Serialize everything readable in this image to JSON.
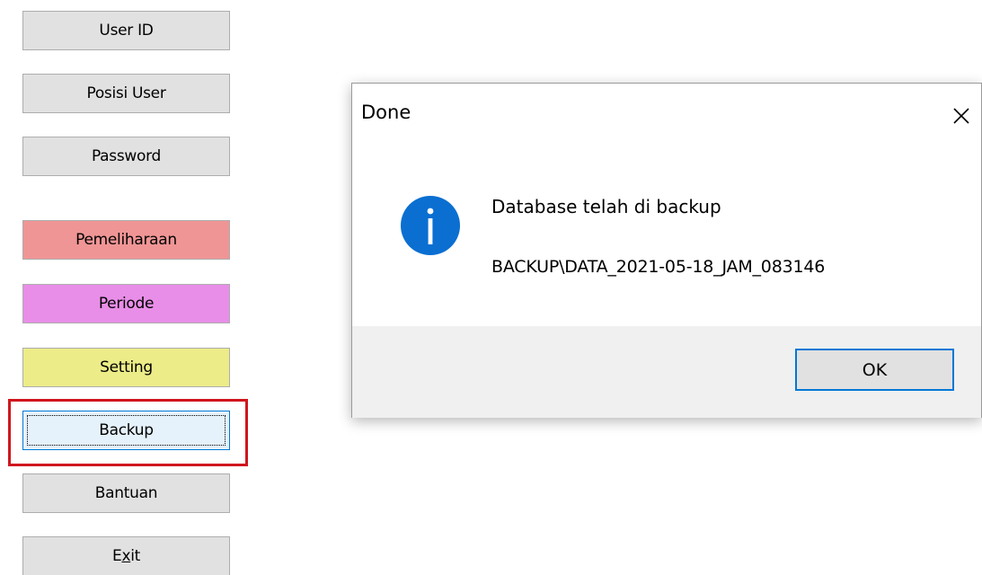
{
  "menu": {
    "user_id": "User ID",
    "posisi_user": "Posisi User",
    "password": "Password",
    "pemeliharaan": "Pemeliharaan",
    "periode": "Periode",
    "setting": "Setting",
    "backup": "Backup",
    "bantuan": "Bantuan",
    "exit_prefix": "E",
    "exit_mnemonic": "x",
    "exit_suffix": "it"
  },
  "colors": {
    "default_button": "#e1e1e1",
    "pemeliharaan": "#f09595",
    "periode": "#e88ee8",
    "setting": "#ecec88",
    "backup_focused": "#e5f1fb",
    "highlight_outline": "#d0161e",
    "accent": "#0078d7",
    "info_icon": "#0a6fd1"
  },
  "dialog": {
    "title": "Done",
    "message": "Database telah di backup",
    "path": "BACKUP\\DATA_2021-05-18_JAM_083146",
    "ok_label": "OK",
    "icon": "info-icon",
    "close_icon": "close-icon"
  }
}
